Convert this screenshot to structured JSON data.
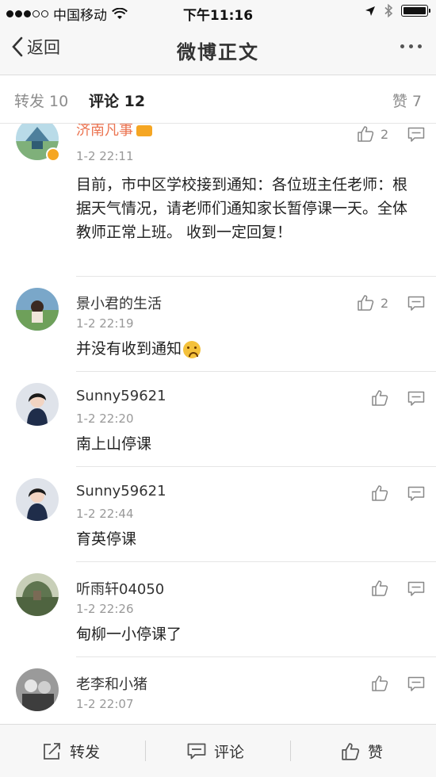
{
  "status_bar": {
    "carrier": "中国移动",
    "time": "下午11:16"
  },
  "nav": {
    "back_label": "返回",
    "title": "微博正文"
  },
  "tabs": {
    "forward": "转发 10",
    "comment": "评论 12",
    "like": "赞 7"
  },
  "comments": [
    {
      "name": "济南凡事",
      "time": "1-2 22:11",
      "text": "目前，市中区学校接到通知：各位班主任老师：根据天气情况，请老师们通知家长暂停课一天。全体教师正常上班。 收到一定回复！",
      "likes": "2",
      "verified": true
    },
    {
      "name": "景小君的生活",
      "time": "1-2 22:19",
      "text": "并没有收到通知",
      "likes": "2"
    },
    {
      "name": "Sunny59621",
      "time": "1-2 22:20",
      "text": "南上山停课",
      "likes": ""
    },
    {
      "name": "Sunny59621",
      "time": "1-2 22:44",
      "text": "育英停课",
      "likes": ""
    },
    {
      "name": "听雨轩04050",
      "time": "1-2 22:26",
      "text": "甸柳一小停课了",
      "likes": ""
    },
    {
      "name": "老李和小猪",
      "time": "1-2 22:07",
      "text": "",
      "likes": ""
    }
  ],
  "bottom_bar": {
    "forward": "转发",
    "comment": "评论",
    "like": "赞"
  },
  "colors": {
    "accent_name": "#eb7350",
    "time_gray": "#999999",
    "bar_bg": "#f7f7f7"
  }
}
